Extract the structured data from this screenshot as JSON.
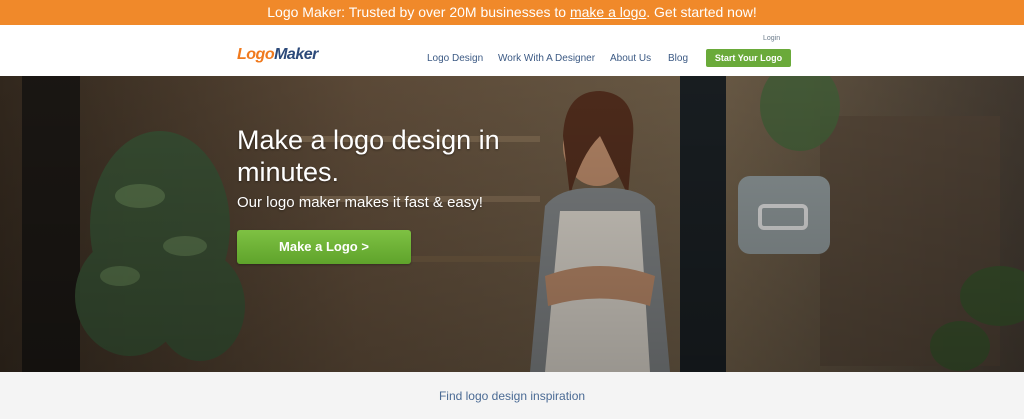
{
  "promo": {
    "prefix": "Logo Maker: Trusted by over 20M businesses to ",
    "link": "make a logo",
    "suffix": ". Get started now!"
  },
  "header": {
    "logo_part1": "Logo",
    "logo_part2": "Maker",
    "login": "Login",
    "nav": [
      "Logo Design",
      "Work With A Designer",
      "About Us",
      "Blog"
    ],
    "cta": "Start Your Logo"
  },
  "hero": {
    "title": "Make a logo design in minutes.",
    "subtitle": "Our logo maker makes it fast & easy!",
    "button": "Make a Logo >"
  },
  "footer": {
    "inspiration": "Find logo design inspiration"
  },
  "colors": {
    "promo_bg": "#f0892a",
    "cta_green": "#6aaa3a",
    "nav_blue": "#3c5a84",
    "logo_orange": "#f07a1e",
    "logo_navy": "#2c4a7a"
  }
}
